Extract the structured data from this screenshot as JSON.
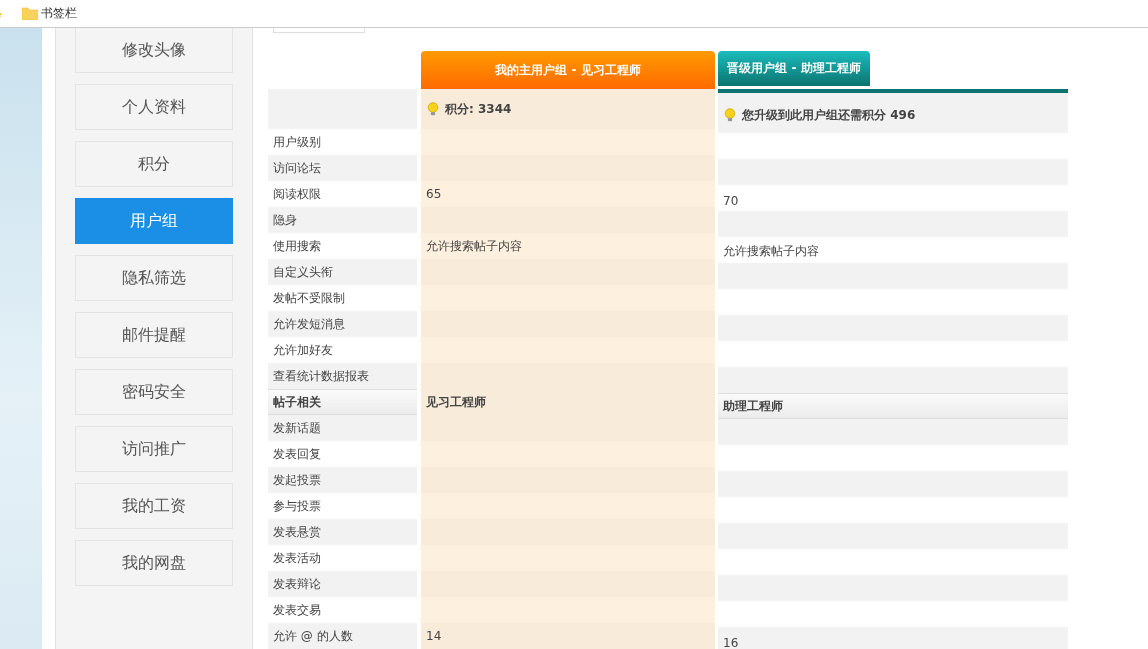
{
  "bookmarks_bar": {
    "folder": "书签栏"
  },
  "sidebar": {
    "items": [
      {
        "label": "修改头像",
        "selected": false
      },
      {
        "label": "个人资料",
        "selected": false
      },
      {
        "label": "积分",
        "selected": false
      },
      {
        "label": "用户组",
        "selected": true
      },
      {
        "label": "隐私筛选",
        "selected": false
      },
      {
        "label": "邮件提醒",
        "selected": false
      },
      {
        "label": "密码安全",
        "selected": false
      },
      {
        "label": "访问推广",
        "selected": false
      },
      {
        "label": "我的工资",
        "selected": false
      },
      {
        "label": "我的网盘",
        "selected": false
      }
    ]
  },
  "groups": {
    "main": {
      "title": "我的主用户组 - 见习工程师",
      "points": "积分: 3344"
    },
    "upgrade": {
      "title": "晋级用户组 - 助理工程师",
      "points": "您升级到此用户组还需积分 496"
    }
  },
  "rows": [
    {
      "kind": "perm",
      "label": "用户级别"
    },
    {
      "kind": "perm",
      "label": "访问论坛"
    },
    {
      "kind": "perm",
      "label": "阅读权限",
      "main": "65",
      "upgrade": "70"
    },
    {
      "kind": "perm",
      "label": "隐身"
    },
    {
      "kind": "perm",
      "label": "使用搜索",
      "main": "允许搜索帖子内容",
      "upgrade": "允许搜索帖子内容"
    },
    {
      "kind": "perm",
      "label": "自定义头衔"
    },
    {
      "kind": "perm",
      "label": "发帖不受限制"
    },
    {
      "kind": "perm",
      "label": "允许发短消息"
    },
    {
      "kind": "perm",
      "label": "允许加好友"
    },
    {
      "kind": "perm",
      "label": "查看统计数据报表"
    },
    {
      "kind": "section",
      "label": "帖子相关",
      "main": "见习工程师",
      "upgrade": "助理工程师"
    },
    {
      "kind": "perm",
      "label": "发新话题"
    },
    {
      "kind": "perm",
      "label": "发表回复"
    },
    {
      "kind": "perm",
      "label": "发起投票"
    },
    {
      "kind": "perm",
      "label": "参与投票"
    },
    {
      "kind": "perm",
      "label": "发表悬赏"
    },
    {
      "kind": "perm",
      "label": "发表活动"
    },
    {
      "kind": "perm",
      "label": "发表辩论"
    },
    {
      "kind": "perm",
      "label": "发表交易"
    },
    {
      "kind": "perm",
      "label": "允许 @ 的人数",
      "main": "14",
      "upgrade": "16"
    }
  ]
}
